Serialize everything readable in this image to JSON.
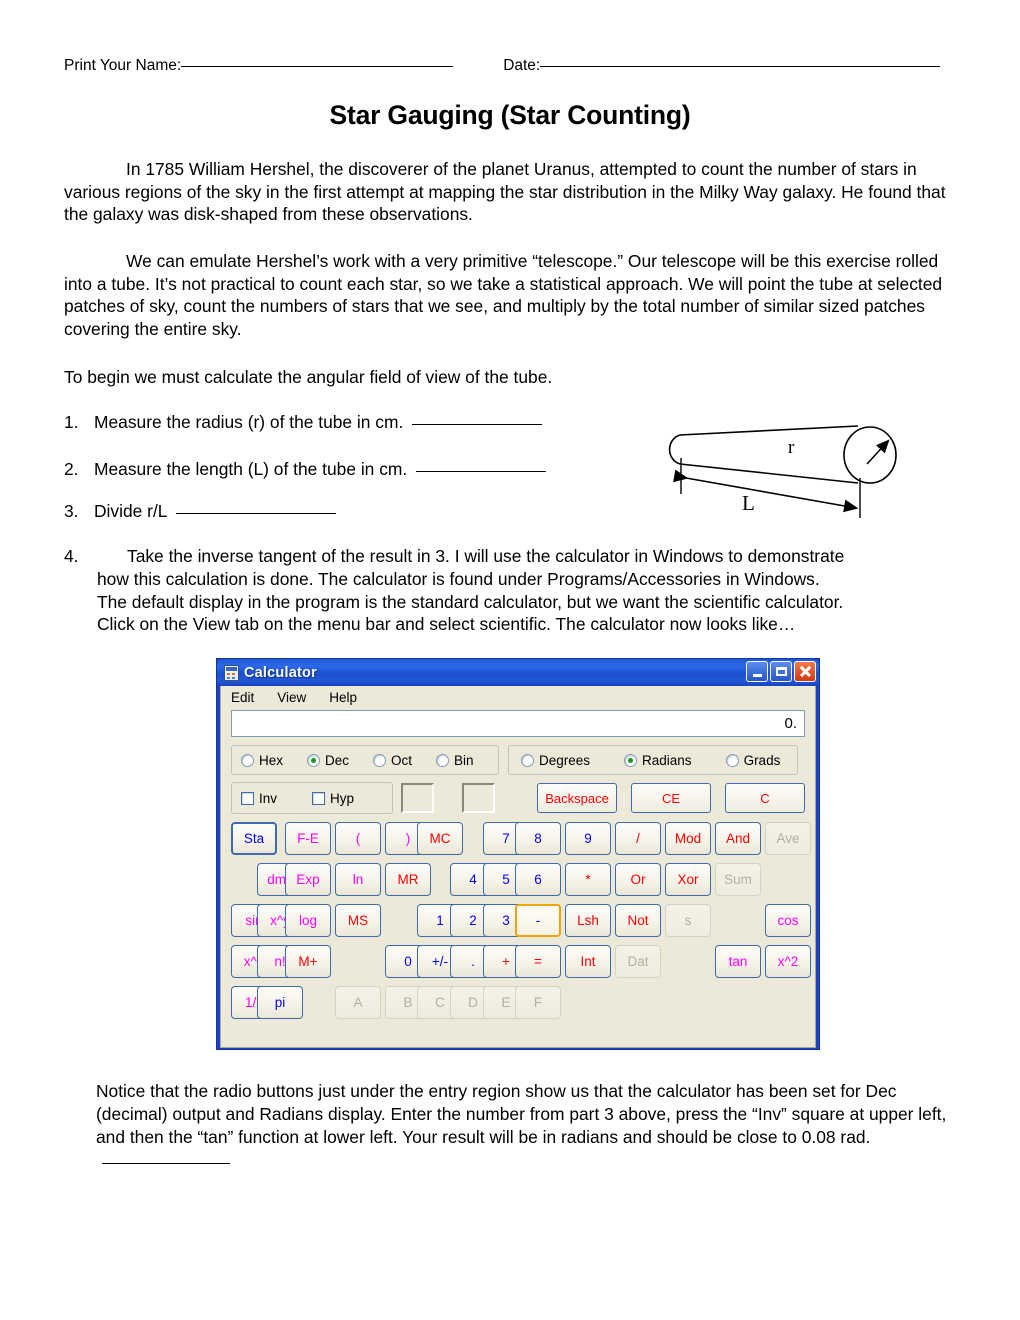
{
  "header": {
    "name_label": "Print Your Name:",
    "date_label": "Date:"
  },
  "title": "Star Gauging (Star Counting)",
  "paragraphs": {
    "p1": "In 1785 William Hershel, the discoverer of the planet Uranus, attempted to count the number of stars in various regions of the sky in the first attempt at mapping the star distribution in the Milky Way galaxy.  He found that the galaxy was disk-shaped from these observations.",
    "p2": "We can emulate Hershel’s work with a very primitive “telescope.”  Our telescope will be this exercise rolled into a tube.  It’s not practical to count each star, so we take a statistical approach.  We will point the tube at selected patches of sky, count the numbers of stars that we see, and multiply by the total number of similar sized patches covering the entire sky.",
    "p3": "To begin we must calculate the angular field of view of the tube.",
    "p4": "Notice that the radio buttons just under the entry region show us that the calculator has been set for Dec (decimal) output and Radians display.  Enter the number from part 3 above, press the “Inv” square at upper left, and then the “tan” function at lower left.  Your result will be in radians and should be close to 0.08 rad."
  },
  "steps": {
    "n1": "1.",
    "t1": "Measure the radius (r) of the tube in cm.",
    "n2": "2.",
    "t2": "Measure the length (L) of the tube in cm.",
    "n3": "3.",
    "t3": "Divide r/L",
    "n4": "4.",
    "t4_line1": "Take the inverse tangent of the result in 3.  I will use the calculator in Windows to demonstrate",
    "t4_line2": "how this calculation is done.  The calculator is found under Programs/Accessories in Windows.",
    "t4_line3": "The default display in the program is the standard calculator, but we want the scientific calculator.",
    "t4_line4": "Click on the View tab on the menu bar and select scientific.  The calculator now looks like…"
  },
  "diagram": {
    "radius_label": "r",
    "length_label": "L"
  },
  "calculator": {
    "window_title": "Calculator",
    "icon": "calculator-icon",
    "window_buttons": {
      "minimize": "minimize-icon",
      "maximize": "maximize-icon",
      "close": "close-icon"
    },
    "menu": [
      "Edit",
      "View",
      "Help"
    ],
    "display_value": "0.",
    "base_group": [
      {
        "label": "Hex",
        "selected": false
      },
      {
        "label": "Dec",
        "selected": true
      },
      {
        "label": "Oct",
        "selected": false
      },
      {
        "label": "Bin",
        "selected": false
      }
    ],
    "angle_group": [
      {
        "label": "Degrees",
        "selected": false
      },
      {
        "label": "Radians",
        "selected": true
      },
      {
        "label": "Grads",
        "selected": false
      }
    ],
    "checkboxes": [
      {
        "label": "Inv",
        "checked": false
      },
      {
        "label": "Hyp",
        "checked": false
      }
    ],
    "edit_buttons": [
      {
        "label": "Backspace",
        "color": "#ff0000"
      },
      {
        "label": "CE",
        "color": "#ff0000"
      },
      {
        "label": "C",
        "color": "#ff0000"
      }
    ],
    "accent_selected": "#f0a30a",
    "colors": {
      "digit": "#0000ff",
      "function": "#ff00ff",
      "memory_operator": "#ff0000",
      "disabled": "#b4b0a0",
      "face": "#ece9d8",
      "titlebar": "#1f57d8"
    },
    "keys": [
      [
        {
          "label": "Sta",
          "style": "blue-outline",
          "disabled": false
        },
        {
          "label": "F-E",
          "style": "magenta",
          "disabled": false
        },
        {
          "label": "(",
          "style": "magenta",
          "disabled": false
        },
        {
          "label": ")",
          "style": "magenta",
          "disabled": false
        },
        {
          "label": "MC",
          "style": "red",
          "disabled": false
        },
        {
          "label": "7",
          "style": "blue",
          "disabled": false
        },
        {
          "label": "8",
          "style": "blue",
          "disabled": false
        },
        {
          "label": "9",
          "style": "blue",
          "disabled": false
        },
        {
          "label": "/",
          "style": "red",
          "disabled": false
        },
        {
          "label": "Mod",
          "style": "red",
          "disabled": false
        },
        {
          "label": "And",
          "style": "red",
          "disabled": false
        }
      ],
      [
        {
          "label": "Ave",
          "style": "disabled",
          "disabled": true
        },
        {
          "label": "dms",
          "style": "magenta",
          "disabled": false
        },
        {
          "label": "Exp",
          "style": "magenta",
          "disabled": false
        },
        {
          "label": "ln",
          "style": "magenta",
          "disabled": false
        },
        {
          "label": "MR",
          "style": "red",
          "disabled": false
        },
        {
          "label": "4",
          "style": "blue",
          "disabled": false
        },
        {
          "label": "5",
          "style": "blue",
          "disabled": false
        },
        {
          "label": "6",
          "style": "blue",
          "disabled": false
        },
        {
          "label": "*",
          "style": "red",
          "disabled": false
        },
        {
          "label": "Or",
          "style": "red",
          "disabled": false
        },
        {
          "label": "Xor",
          "style": "red",
          "disabled": false
        }
      ],
      [
        {
          "label": "Sum",
          "style": "disabled",
          "disabled": true
        },
        {
          "label": "sin",
          "style": "magenta",
          "disabled": false
        },
        {
          "label": "x^y",
          "style": "magenta",
          "disabled": false
        },
        {
          "label": "log",
          "style": "magenta",
          "disabled": false
        },
        {
          "label": "MS",
          "style": "red",
          "disabled": false
        },
        {
          "label": "1",
          "style": "blue",
          "disabled": false
        },
        {
          "label": "2",
          "style": "blue",
          "disabled": false
        },
        {
          "label": "3",
          "style": "blue",
          "disabled": false
        },
        {
          "label": "-",
          "style": "hover",
          "disabled": false
        },
        {
          "label": "Lsh",
          "style": "red",
          "disabled": false
        },
        {
          "label": "Not",
          "style": "red",
          "disabled": false
        }
      ],
      [
        {
          "label": "s",
          "style": "disabled",
          "disabled": true
        },
        {
          "label": "cos",
          "style": "magenta",
          "disabled": false
        },
        {
          "label": "x^3",
          "style": "magenta",
          "disabled": false
        },
        {
          "label": "n!",
          "style": "magenta",
          "disabled": false
        },
        {
          "label": "M+",
          "style": "red",
          "disabled": false
        },
        {
          "label": "0",
          "style": "blue",
          "disabled": false
        },
        {
          "label": "+/-",
          "style": "blue",
          "disabled": false
        },
        {
          "label": ".",
          "style": "blue",
          "disabled": false
        },
        {
          "label": "+",
          "style": "red",
          "disabled": false
        },
        {
          "label": "=",
          "style": "red",
          "disabled": false
        },
        {
          "label": "Int",
          "style": "red",
          "disabled": false
        }
      ],
      [
        {
          "label": "Dat",
          "style": "disabled",
          "disabled": true
        },
        {
          "label": "tan",
          "style": "magenta",
          "disabled": false
        },
        {
          "label": "x^2",
          "style": "magenta",
          "disabled": false
        },
        {
          "label": "1/x",
          "style": "magenta",
          "disabled": false
        },
        {
          "label": "pi",
          "style": "blue",
          "disabled": false
        },
        {
          "label": "A",
          "style": "disabled",
          "disabled": true
        },
        {
          "label": "B",
          "style": "disabled",
          "disabled": true
        },
        {
          "label": "C",
          "style": "disabled",
          "disabled": true
        },
        {
          "label": "D",
          "style": "disabled",
          "disabled": true
        },
        {
          "label": "E",
          "style": "disabled",
          "disabled": true
        },
        {
          "label": "F",
          "style": "disabled",
          "disabled": true
        }
      ]
    ]
  }
}
